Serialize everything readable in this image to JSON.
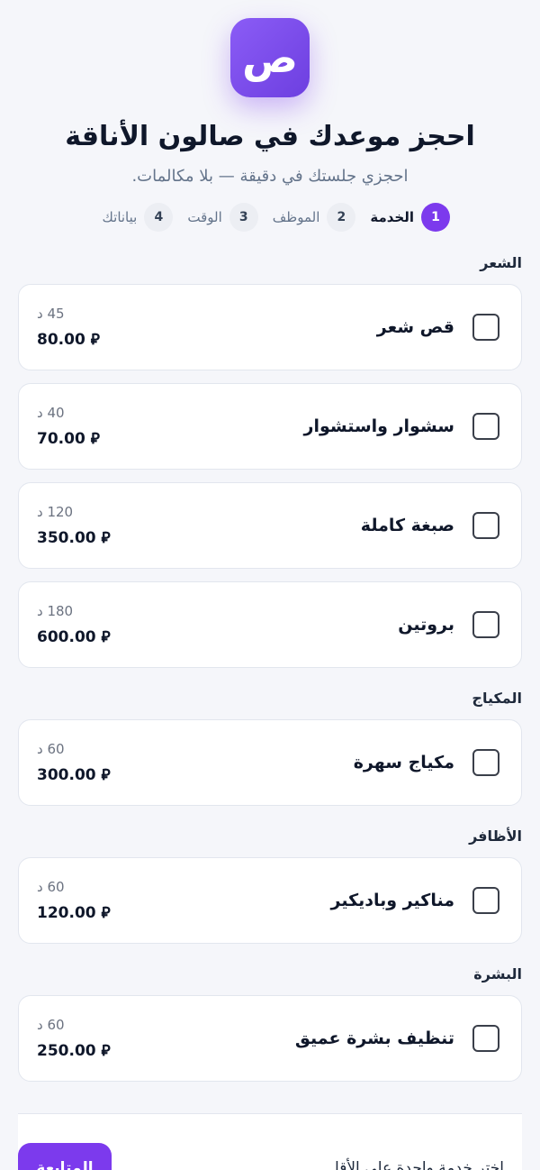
{
  "header": {
    "logo_glyph": "ص",
    "title": "احجز موعدك في صالون الأناقة",
    "subtitle": "احجزي جلستك في دقيقة — بلا مكالمات."
  },
  "steps": [
    {
      "num": "1",
      "label": "الخدمة",
      "active": true
    },
    {
      "num": "2",
      "label": "الموظف",
      "active": false
    },
    {
      "num": "3",
      "label": "الوقت",
      "active": false
    },
    {
      "num": "4",
      "label": "بياناتك",
      "active": false
    }
  ],
  "sections": [
    {
      "title": "الشعر",
      "services": [
        {
          "name": "قص شعر",
          "duration": "45 د",
          "price": "80.00 ⃁"
        },
        {
          "name": "سشوار واستشوار",
          "duration": "40 د",
          "price": "70.00 ⃁"
        },
        {
          "name": "صبغة كاملة",
          "duration": "120 د",
          "price": "350.00 ⃁"
        },
        {
          "name": "بروتين",
          "duration": "180 د",
          "price": "600.00 ⃁"
        }
      ]
    },
    {
      "title": "المكياج",
      "services": [
        {
          "name": "مكياج سهرة",
          "duration": "60 د",
          "price": "300.00 ⃁"
        }
      ]
    },
    {
      "title": "الأظافر",
      "services": [
        {
          "name": "مناكير وباديكير",
          "duration": "60 د",
          "price": "120.00 ⃁"
        }
      ]
    },
    {
      "title": "البشرة",
      "services": [
        {
          "name": "تنظيف بشرة عميق",
          "duration": "60 د",
          "price": "250.00 ⃁"
        }
      ]
    }
  ],
  "footer": {
    "hint": "اختر خدمة واحدة على الأقل",
    "continue_label": "المتابعة"
  },
  "colors": {
    "accent": "#7c3aed",
    "background": "#f5f6fa"
  }
}
